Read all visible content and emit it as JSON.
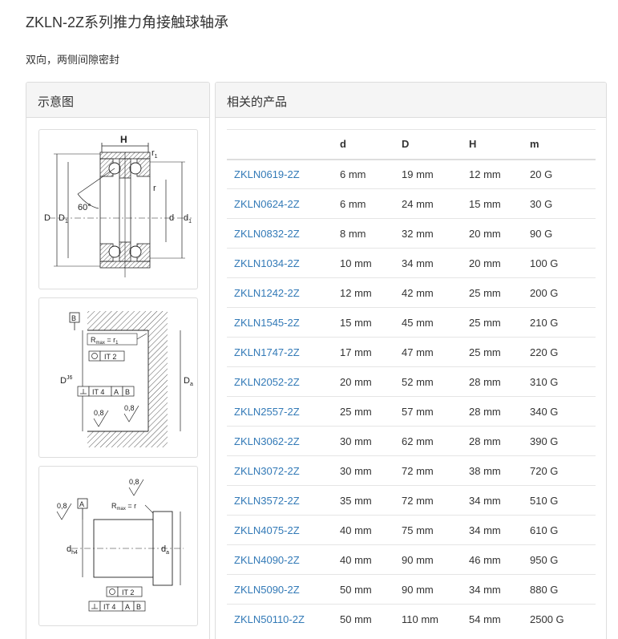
{
  "page": {
    "title": "ZKLN-2Z系列推力角接触球轴承",
    "subtitle": "双向，两侧间隙密封"
  },
  "left_panel": {
    "title": "示意图",
    "diagram1": {
      "h": "H",
      "r1": "r",
      "r1_sub": "1",
      "r": "r",
      "angle": "60°",
      "D": "D",
      "D1": "D",
      "D1_sub": "1",
      "d": "d",
      "d1": "d",
      "d1_sub": "1"
    },
    "diagram2": {
      "datum": "B",
      "rmax": "R",
      "rmax_sub": "max",
      "rmax_val": " = r",
      "rmax_val_sub": "1",
      "it2": "IT 2",
      "dj6": "D",
      "dj6_sup": "J6",
      "it4": "IT 4",
      "a": "A",
      "b": "B",
      "da": "D",
      "da_sub": "a",
      "rough1": "0,8",
      "rough2": "0,8"
    },
    "diagram3": {
      "rough_top": "0,8",
      "rough_left": "0,8",
      "datum": "A",
      "rmax": "R",
      "rmax_sub": "max",
      "rmax_val": " = r",
      "dh4": "d",
      "dh4_sub": "h4",
      "da": "d",
      "da_sub": "a",
      "it2": "IT 2",
      "it4": "IT 4",
      "a": "A",
      "b": "B"
    }
  },
  "right_panel": {
    "title": "相关的产品",
    "columns": [
      "",
      "d",
      "D",
      "H",
      "m"
    ],
    "rows": [
      {
        "name": "ZKLN0619-2Z",
        "d": "6 mm",
        "D": "19 mm",
        "H": "12 mm",
        "m": "20 G"
      },
      {
        "name": "ZKLN0624-2Z",
        "d": "6 mm",
        "D": "24 mm",
        "H": "15 mm",
        "m": "30 G"
      },
      {
        "name": "ZKLN0832-2Z",
        "d": "8 mm",
        "D": "32 mm",
        "H": "20 mm",
        "m": "90 G"
      },
      {
        "name": "ZKLN1034-2Z",
        "d": "10 mm",
        "D": "34 mm",
        "H": "20 mm",
        "m": "100 G"
      },
      {
        "name": "ZKLN1242-2Z",
        "d": "12 mm",
        "D": "42 mm",
        "H": "25 mm",
        "m": "200 G"
      },
      {
        "name": "ZKLN1545-2Z",
        "d": "15 mm",
        "D": "45 mm",
        "H": "25 mm",
        "m": "210 G"
      },
      {
        "name": "ZKLN1747-2Z",
        "d": "17 mm",
        "D": "47 mm",
        "H": "25 mm",
        "m": "220 G"
      },
      {
        "name": "ZKLN2052-2Z",
        "d": "20 mm",
        "D": "52 mm",
        "H": "28 mm",
        "m": "310 G"
      },
      {
        "name": "ZKLN2557-2Z",
        "d": "25 mm",
        "D": "57 mm",
        "H": "28 mm",
        "m": "340 G"
      },
      {
        "name": "ZKLN3062-2Z",
        "d": "30 mm",
        "D": "62 mm",
        "H": "28 mm",
        "m": "390 G"
      },
      {
        "name": "ZKLN3072-2Z",
        "d": "30 mm",
        "D": "72 mm",
        "H": "38 mm",
        "m": "720 G"
      },
      {
        "name": "ZKLN3572-2Z",
        "d": "35 mm",
        "D": "72 mm",
        "H": "34 mm",
        "m": "510 G"
      },
      {
        "name": "ZKLN4075-2Z",
        "d": "40 mm",
        "D": "75 mm",
        "H": "34 mm",
        "m": "610 G"
      },
      {
        "name": "ZKLN4090-2Z",
        "d": "40 mm",
        "D": "90 mm",
        "H": "46 mm",
        "m": "950 G"
      },
      {
        "name": "ZKLN5090-2Z",
        "d": "50 mm",
        "D": "90 mm",
        "H": "34 mm",
        "m": "880 G"
      },
      {
        "name": "ZKLN50110-2Z",
        "d": "50 mm",
        "D": "110 mm",
        "H": "54 mm",
        "m": "2500 G"
      }
    ]
  }
}
